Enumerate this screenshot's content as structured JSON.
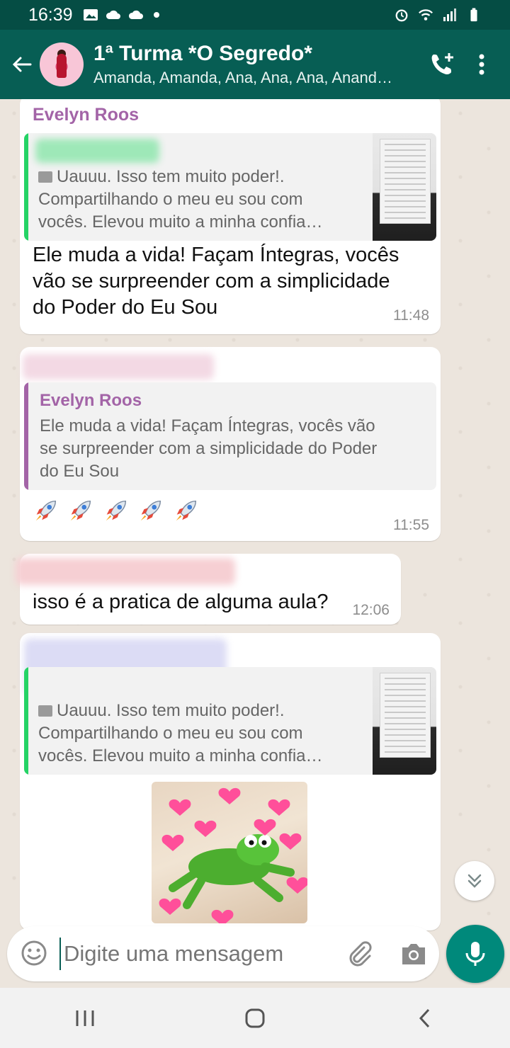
{
  "status_bar": {
    "time": "16:39"
  },
  "header": {
    "title": "1ª Turma *O Segredo*",
    "subtitle": "Amanda, Amanda, Ana, Ana, Ana, Anand…"
  },
  "messages": [
    {
      "sender": "Evelyn Roos",
      "quote_text": [
        "Uauuu. Isso tem muito poder!.",
        "Compartilhando o meu eu sou com",
        "vocês. Elevou muito a minha confia…"
      ],
      "text": [
        "Ele muda a vida! Façam Íntegras, vocês",
        "vão se surpreender com a simplicidade",
        "do Poder do Eu  Sou"
      ],
      "time": "11:48"
    },
    {
      "quote_name": "Evelyn Roos",
      "quote_text": [
        "Ele muda a vida! Façam Íntegras, vocês vão",
        "se surpreender com a simplicidade do Poder",
        "do Eu  Sou"
      ],
      "time": "11:55"
    },
    {
      "text": "isso é a pratica de alguma aula?",
      "time": "12:06"
    },
    {
      "quote_text": [
        "Uauuu. Isso tem muito poder!.",
        "Compartilhando o meu eu sou com",
        "vocês. Elevou muito a minha confia…"
      ]
    }
  ],
  "input": {
    "placeholder": "Digite uma mensagem"
  },
  "colors": {
    "header": "#075e54",
    "status_bar": "#054d44",
    "accent": "#00897b",
    "sender_name": "#a364a7",
    "quote_green": "#25d366",
    "quote_purple": "#a364a7"
  }
}
